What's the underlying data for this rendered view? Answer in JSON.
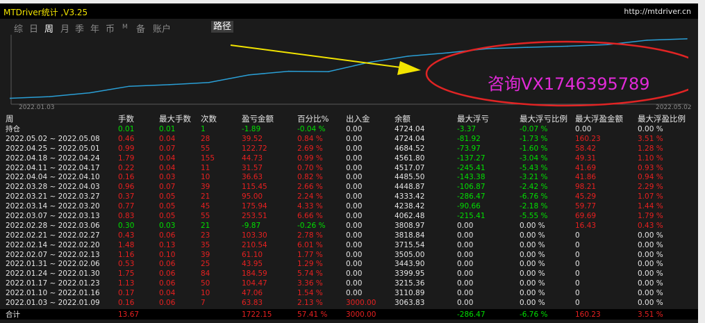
{
  "window": {
    "title": "MTDriver统计 ,V3.25",
    "url": "http://mtdriver.cn"
  },
  "tabs": [
    {
      "label": "综",
      "active": false
    },
    {
      "label": "日",
      "active": false
    },
    {
      "label": "周",
      "active": true
    },
    {
      "label": "月",
      "active": false
    },
    {
      "label": "季",
      "active": false
    },
    {
      "label": "年",
      "active": false
    },
    {
      "label": "币",
      "active": false
    },
    {
      "label": "M",
      "active": false
    },
    {
      "label": "备",
      "active": false
    },
    {
      "label": "账户",
      "active": false
    }
  ],
  "path_button": "路径",
  "chart": {
    "start_date": "2022.01.03",
    "end_date": "2022.05.02",
    "line_color": "#2a9fd6",
    "annotation_text": "咨询VX1746395789",
    "annotation_color": "#e12ad8",
    "ellipse_color": "#e02424",
    "arrow_color": "#f2e400"
  },
  "chart_data": {
    "type": "line",
    "x": [
      "2022.01.03",
      "2022.01.10",
      "2022.01.17",
      "2022.01.24",
      "2022.01.31",
      "2022.02.07",
      "2022.02.14",
      "2022.02.21",
      "2022.02.28",
      "2022.03.07",
      "2022.03.14",
      "2022.03.21",
      "2022.03.28",
      "2022.04.04",
      "2022.04.11",
      "2022.04.18",
      "2022.04.25",
      "2022.05.02"
    ],
    "y": [
      3063.83,
      3110.89,
      3215.36,
      3399.95,
      3443.9,
      3505.0,
      3715.54,
      3818.84,
      3808.97,
      4062.48,
      4238.42,
      4333.42,
      4448.87,
      4485.5,
      4517.07,
      4561.8,
      4684.52,
      4724.04
    ],
    "ylabel": "余额",
    "grid": false
  },
  "table": {
    "headers": [
      "周",
      "手数",
      "最大手数",
      "次数",
      "盈亏金额",
      "百分比%",
      "出入金",
      "余额",
      "最大浮亏",
      "最大浮亏比例",
      "最大浮盈金额",
      "最大浮盈比例"
    ],
    "rows": [
      {
        "cells": [
          "持仓",
          "0.01",
          "0.01",
          "1",
          "-1.89",
          "-0.04 %",
          "0.00",
          "4724.04",
          "-3.37",
          "-0.07 %",
          "0.00",
          "0.00 %"
        ],
        "colors": [
          "w",
          "g",
          "g",
          "g",
          "g",
          "g",
          "w",
          "w",
          "g",
          "g",
          "w",
          "w"
        ]
      },
      {
        "cells": [
          "2022.05.02 ~ 2022.05.08",
          "0.46",
          "0.04",
          "28",
          "39.52",
          "0.84 %",
          "0.00",
          "4724.04",
          "-81.92",
          "-1.73 %",
          "160.23",
          "3.51 %"
        ],
        "colors": [
          "w",
          "r",
          "r",
          "r",
          "r",
          "r",
          "w",
          "w",
          "g",
          "g",
          "r",
          "r"
        ]
      },
      {
        "cells": [
          "2022.04.25 ~ 2022.05.01",
          "0.99",
          "0.07",
          "55",
          "122.72",
          "2.69 %",
          "0.00",
          "4684.52",
          "-73.97",
          "-1.60 %",
          "58.42",
          "1.28 %"
        ],
        "colors": [
          "w",
          "r",
          "r",
          "r",
          "r",
          "r",
          "w",
          "w",
          "g",
          "g",
          "r",
          "r"
        ]
      },
      {
        "cells": [
          "2022.04.18 ~ 2022.04.24",
          "1.79",
          "0.04",
          "155",
          "44.73",
          "0.99 %",
          "0.00",
          "4561.80",
          "-137.27",
          "-3.04 %",
          "49.31",
          "1.10 %"
        ],
        "colors": [
          "w",
          "r",
          "r",
          "r",
          "r",
          "r",
          "w",
          "w",
          "g",
          "g",
          "r",
          "r"
        ]
      },
      {
        "cells": [
          "2022.04.11 ~ 2022.04.17",
          "0.22",
          "0.04",
          "11",
          "31.57",
          "0.70 %",
          "0.00",
          "4517.07",
          "-245.41",
          "-5.43 %",
          "41.69",
          "0.93 %"
        ],
        "colors": [
          "w",
          "r",
          "r",
          "r",
          "r",
          "r",
          "w",
          "w",
          "g",
          "g",
          "r",
          "r"
        ]
      },
      {
        "cells": [
          "2022.04.04 ~ 2022.04.10",
          "0.16",
          "0.03",
          "10",
          "36.63",
          "0.82 %",
          "0.00",
          "4485.50",
          "-143.38",
          "-3.21 %",
          "41.86",
          "0.94 %"
        ],
        "colors": [
          "w",
          "r",
          "r",
          "r",
          "r",
          "r",
          "w",
          "w",
          "g",
          "g",
          "r",
          "r"
        ]
      },
      {
        "cells": [
          "2022.03.28 ~ 2022.04.03",
          "0.96",
          "0.07",
          "39",
          "115.45",
          "2.66 %",
          "0.00",
          "4448.87",
          "-106.87",
          "-2.42 %",
          "98.21",
          "2.29 %"
        ],
        "colors": [
          "w",
          "r",
          "r",
          "r",
          "r",
          "r",
          "w",
          "w",
          "g",
          "g",
          "r",
          "r"
        ]
      },
      {
        "cells": [
          "2022.03.21 ~ 2022.03.27",
          "0.37",
          "0.05",
          "21",
          "95.00",
          "2.24 %",
          "0.00",
          "4333.42",
          "-286.47",
          "-6.76 %",
          "45.29",
          "1.07 %"
        ],
        "colors": [
          "w",
          "r",
          "r",
          "r",
          "r",
          "r",
          "w",
          "w",
          "g",
          "g",
          "r",
          "r"
        ]
      },
      {
        "cells": [
          "2022.03.14 ~ 2022.03.20",
          "0.77",
          "0.05",
          "45",
          "175.94",
          "4.33 %",
          "0.00",
          "4238.42",
          "-90.66",
          "-2.18 %",
          "59.77",
          "1.44 %"
        ],
        "colors": [
          "w",
          "r",
          "r",
          "r",
          "r",
          "r",
          "w",
          "w",
          "g",
          "g",
          "r",
          "r"
        ]
      },
      {
        "cells": [
          "2022.03.07 ~ 2022.03.13",
          "0.83",
          "0.05",
          "55",
          "253.51",
          "6.66 %",
          "0.00",
          "4062.48",
          "-215.41",
          "-5.55 %",
          "69.69",
          "1.79 %"
        ],
        "colors": [
          "w",
          "r",
          "r",
          "r",
          "r",
          "r",
          "w",
          "w",
          "g",
          "g",
          "r",
          "r"
        ]
      },
      {
        "cells": [
          "2022.02.28 ~ 2022.03.06",
          "0.30",
          "0.03",
          "21",
          "-9.87",
          "-0.26 %",
          "0.00",
          "3808.97",
          "0.00",
          "0.00 %",
          "16.43",
          "0.43 %"
        ],
        "colors": [
          "w",
          "g",
          "g",
          "g",
          "g",
          "g",
          "w",
          "w",
          "w",
          "w",
          "r",
          "r"
        ]
      },
      {
        "cells": [
          "2022.02.21 ~ 2022.02.27",
          "0.43",
          "0.06",
          "23",
          "103.30",
          "2.78 %",
          "0.00",
          "3818.84",
          "0.00",
          "0.00 %",
          "0",
          "0.00 %"
        ],
        "colors": [
          "w",
          "r",
          "r",
          "r",
          "r",
          "r",
          "w",
          "w",
          "w",
          "w",
          "w",
          "w"
        ]
      },
      {
        "cells": [
          "2022.02.14 ~ 2022.02.20",
          "1.48",
          "0.13",
          "35",
          "210.54",
          "6.01 %",
          "0.00",
          "3715.54",
          "0.00",
          "0.00 %",
          "0",
          "0.00 %"
        ],
        "colors": [
          "w",
          "r",
          "r",
          "r",
          "r",
          "r",
          "w",
          "w",
          "w",
          "w",
          "w",
          "w"
        ]
      },
      {
        "cells": [
          "2022.02.07 ~ 2022.02.13",
          "1.16",
          "0.10",
          "39",
          "61.10",
          "1.77 %",
          "0.00",
          "3505.00",
          "0.00",
          "0.00 %",
          "0",
          "0.00 %"
        ],
        "colors": [
          "w",
          "r",
          "r",
          "r",
          "r",
          "r",
          "w",
          "w",
          "w",
          "w",
          "w",
          "w"
        ]
      },
      {
        "cells": [
          "2022.01.31 ~ 2022.02.06",
          "0.53",
          "0.06",
          "25",
          "43.95",
          "1.29 %",
          "0.00",
          "3443.90",
          "0.00",
          "0.00 %",
          "0",
          "0.00 %"
        ],
        "colors": [
          "w",
          "r",
          "r",
          "r",
          "r",
          "r",
          "w",
          "w",
          "w",
          "w",
          "w",
          "w"
        ]
      },
      {
        "cells": [
          "2022.01.24 ~ 2022.01.30",
          "1.75",
          "0.06",
          "84",
          "184.59",
          "5.74 %",
          "0.00",
          "3399.95",
          "0.00",
          "0.00 %",
          "0",
          "0.00 %"
        ],
        "colors": [
          "w",
          "r",
          "r",
          "r",
          "r",
          "r",
          "w",
          "w",
          "w",
          "w",
          "w",
          "w"
        ]
      },
      {
        "cells": [
          "2022.01.17 ~ 2022.01.23",
          "1.13",
          "0.06",
          "50",
          "104.47",
          "3.36 %",
          "0.00",
          "3215.36",
          "0.00",
          "0.00 %",
          "0",
          "0.00 %"
        ],
        "colors": [
          "w",
          "r",
          "r",
          "r",
          "r",
          "r",
          "w",
          "w",
          "w",
          "w",
          "w",
          "w"
        ]
      },
      {
        "cells": [
          "2022.01.10 ~ 2022.01.16",
          "0.17",
          "0.04",
          "10",
          "47.06",
          "1.54 %",
          "0.00",
          "3110.89",
          "0.00",
          "0.00 %",
          "0",
          "0.00 %"
        ],
        "colors": [
          "w",
          "r",
          "r",
          "r",
          "r",
          "r",
          "w",
          "w",
          "w",
          "w",
          "w",
          "w"
        ]
      },
      {
        "cells": [
          "2022.01.03 ~ 2022.01.09",
          "0.16",
          "0.06",
          "7",
          "63.83",
          "2.13 %",
          "3000.00",
          "3063.83",
          "0.00",
          "0.00 %",
          "0",
          "0.00 %"
        ],
        "colors": [
          "w",
          "r",
          "r",
          "r",
          "r",
          "r",
          "r",
          "w",
          "w",
          "w",
          "w",
          "w"
        ]
      }
    ],
    "total": {
      "cells": [
        "合计",
        "13.67",
        "",
        "",
        "1722.15",
        "57.41 %",
        "3000.00",
        "",
        "-286.47",
        "-6.76 %",
        "160.23",
        "3.51 %"
      ],
      "colors": [
        "w",
        "r",
        "r",
        "r",
        "r",
        "r",
        "r",
        "w",
        "g",
        "g",
        "r",
        "r"
      ]
    }
  }
}
